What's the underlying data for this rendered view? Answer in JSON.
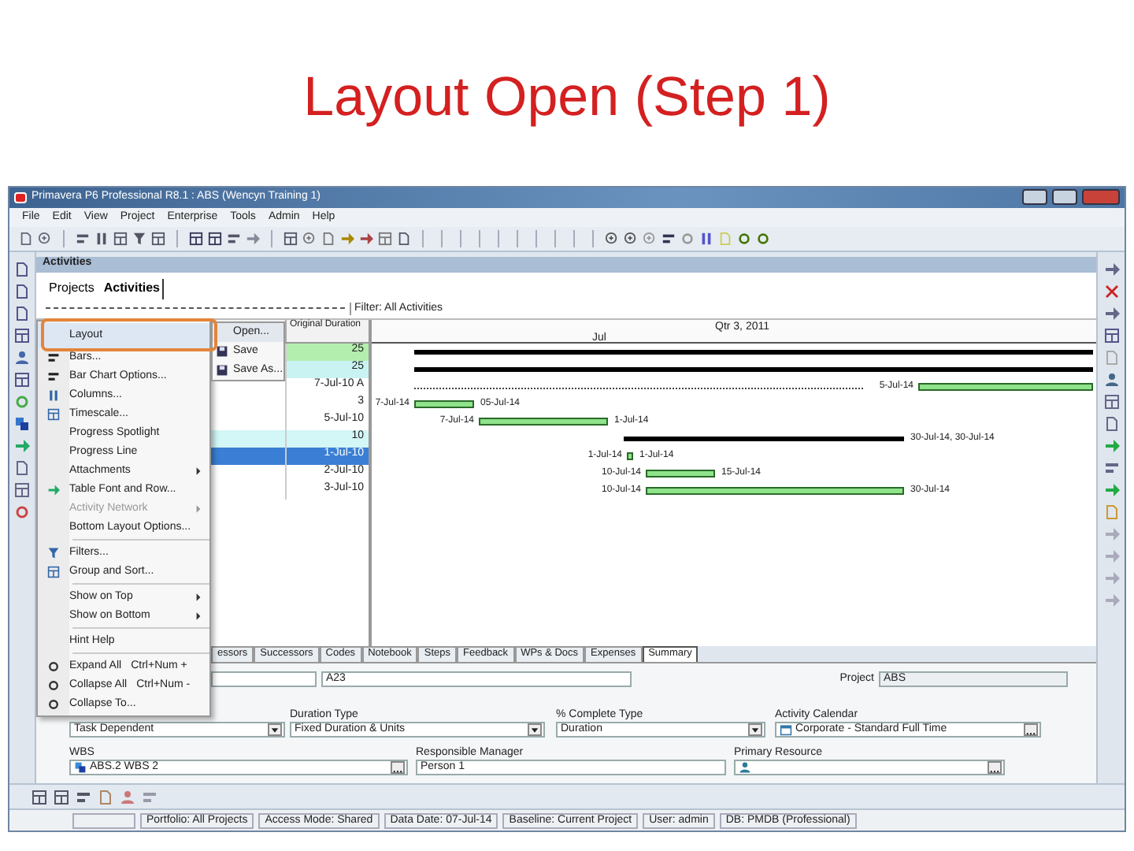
{
  "slide_title": "Layout Open (Step 1)",
  "window": {
    "title": "Primavera P6 Professional R8.1 : ABS (Wencyn Training 1)"
  },
  "menu_bar": [
    "File",
    "Edit",
    "View",
    "Project",
    "Enterprise",
    "Tools",
    "Admin",
    "Help"
  ],
  "panel": {
    "title": "Activities",
    "filter": "Filter: All Activities",
    "tabs": [
      {
        "label": "Projects",
        "selected": false
      },
      {
        "label": "Activities",
        "selected": true
      }
    ]
  },
  "context_menu": [
    {
      "label": "Layout",
      "kind": "item",
      "selected": true,
      "disabled": false
    },
    {
      "label": "Bars...",
      "kind": "item",
      "selected": false,
      "disabled": false
    },
    {
      "label": "Bar Chart Options...",
      "kind": "item",
      "selected": false,
      "disabled": false
    },
    {
      "label": "Columns...",
      "kind": "item",
      "selected": false,
      "disabled": false
    },
    {
      "label": "Timescale...",
      "kind": "item",
      "selected": false,
      "disabled": false
    },
    {
      "label": "Progress Spotlight",
      "kind": "item",
      "selected": false,
      "disabled": false
    },
    {
      "label": "Progress Line",
      "kind": "item",
      "selected": false,
      "disabled": false
    },
    {
      "label": "Attachments",
      "kind": "submenu",
      "selected": false,
      "disabled": false
    },
    {
      "label": "Table Font and Row...",
      "kind": "item",
      "selected": false,
      "disabled": false
    },
    {
      "label": "Activity Network",
      "kind": "submenu",
      "selected": false,
      "disabled": true
    },
    {
      "label": "Bottom Layout Options...",
      "kind": "item",
      "selected": false,
      "disabled": false
    },
    {
      "kind": "separator"
    },
    {
      "label": "Filters...",
      "kind": "item",
      "selected": false,
      "disabled": false
    },
    {
      "label": "Group and Sort...",
      "kind": "item",
      "selected": false,
      "disabled": false
    },
    {
      "kind": "separator"
    },
    {
      "label": "Show on Top",
      "kind": "submenu",
      "selected": false,
      "disabled": false
    },
    {
      "label": "Show on Bottom",
      "kind": "submenu",
      "selected": false,
      "disabled": false
    },
    {
      "kind": "separator"
    },
    {
      "label": "Hint Help",
      "kind": "item",
      "selected": false,
      "disabled": false
    },
    {
      "kind": "separator"
    },
    {
      "label": "Expand All",
      "kind": "item",
      "shortcut": "Ctrl+Num +",
      "selected": false,
      "disabled": false
    },
    {
      "label": "Collapse All",
      "kind": "item",
      "shortcut": "Ctrl+Num -",
      "selected": false,
      "disabled": false
    },
    {
      "label": "Collapse To...",
      "kind": "item",
      "selected": false,
      "disabled": false
    }
  ],
  "layout_submenu": [
    {
      "label": "Open...",
      "selected": true
    },
    {
      "label": "Save",
      "selected": false
    },
    {
      "label": "Save As...",
      "selected": false
    }
  ],
  "table": {
    "column": "Original Duration",
    "rows": [
      {
        "value": "25",
        "color": "#b4eeae",
        "selected": false
      },
      {
        "value": "25",
        "color": "#c9f3f3",
        "selected": false
      },
      {
        "value": "7-Jul-10 A",
        "color": "#ffffff",
        "selected": false
      },
      {
        "value": "3",
        "color": "#ffffff",
        "selected": false
      },
      {
        "value": "5-Jul-10",
        "color": "#ffffff",
        "selected": false
      },
      {
        "value": "10",
        "color": "#d3f6f6",
        "selected": false
      },
      {
        "value": "1-Jul-10",
        "color": "#3a7fd5",
        "selected": true
      },
      {
        "value": "2-Jul-10",
        "color": "#ffffff",
        "selected": false
      },
      {
        "value": "3-Jul-10",
        "color": "#ffffff",
        "selected": false
      }
    ]
  },
  "gantt": {
    "timescale_top": "Qtr 3, 2011",
    "timescale_bottom": "Jul",
    "bars": [
      {
        "kind": "summary"
      },
      {
        "kind": "summary"
      },
      {
        "kind": "task",
        "start_label": "5-Jul-14"
      },
      {
        "kind": "task",
        "start_label": "7-Jul-14",
        "finish_label": "05-Jul-14"
      },
      {
        "kind": "task",
        "start_label": "7-Jul-14",
        "finish_label": "1-Jul-14"
      },
      {
        "kind": "summary",
        "finish_label": "30-Jul-14, 30-Jul-14"
      },
      {
        "kind": "task",
        "start_label": "1-Jul-14",
        "finish_label": "1-Jul-14"
      },
      {
        "kind": "task",
        "start_label": "10-Jul-14",
        "finish_label": "15-Jul-14"
      },
      {
        "kind": "task",
        "start_label": "10-Jul-14",
        "finish_label": "30-Jul-14"
      }
    ]
  },
  "detail_tabs": [
    {
      "label": "essors",
      "selected": false
    },
    {
      "label": "Successors",
      "selected": false
    },
    {
      "label": "Codes",
      "selected": false
    },
    {
      "label": "Notebook",
      "selected": false
    },
    {
      "label": "Steps",
      "selected": false
    },
    {
      "label": "Feedback",
      "selected": false
    },
    {
      "label": "WPs & Docs",
      "selected": false
    },
    {
      "label": "Expenses",
      "selected": false
    },
    {
      "label": "Summary",
      "selected": true
    }
  ],
  "detail": {
    "activity_id": "A23",
    "project_label": "Project",
    "project": "ABS",
    "duration_type_label": "Duration Type",
    "duration_type": "Fixed Duration & Units",
    "percent_complete_type_label": "% Complete Type",
    "percent_complete_type": "Duration",
    "calendar_label": "Activity Calendar",
    "calendar": "Corporate - Standard Full Time",
    "activity_type": "Task Dependent",
    "wbs_label": "WBS",
    "wbs": "ABS.2 WBS 2",
    "manager_label": "Responsible Manager",
    "manager": "Person 1",
    "resource_label": "Primary Resource"
  },
  "status_bar": [
    "Portfolio: All Projects",
    "Access Mode: Shared",
    "Data Date: 07-Jul-14",
    "Baseline: Current Project",
    "User: admin",
    "DB: PMDB (Professional)"
  ]
}
